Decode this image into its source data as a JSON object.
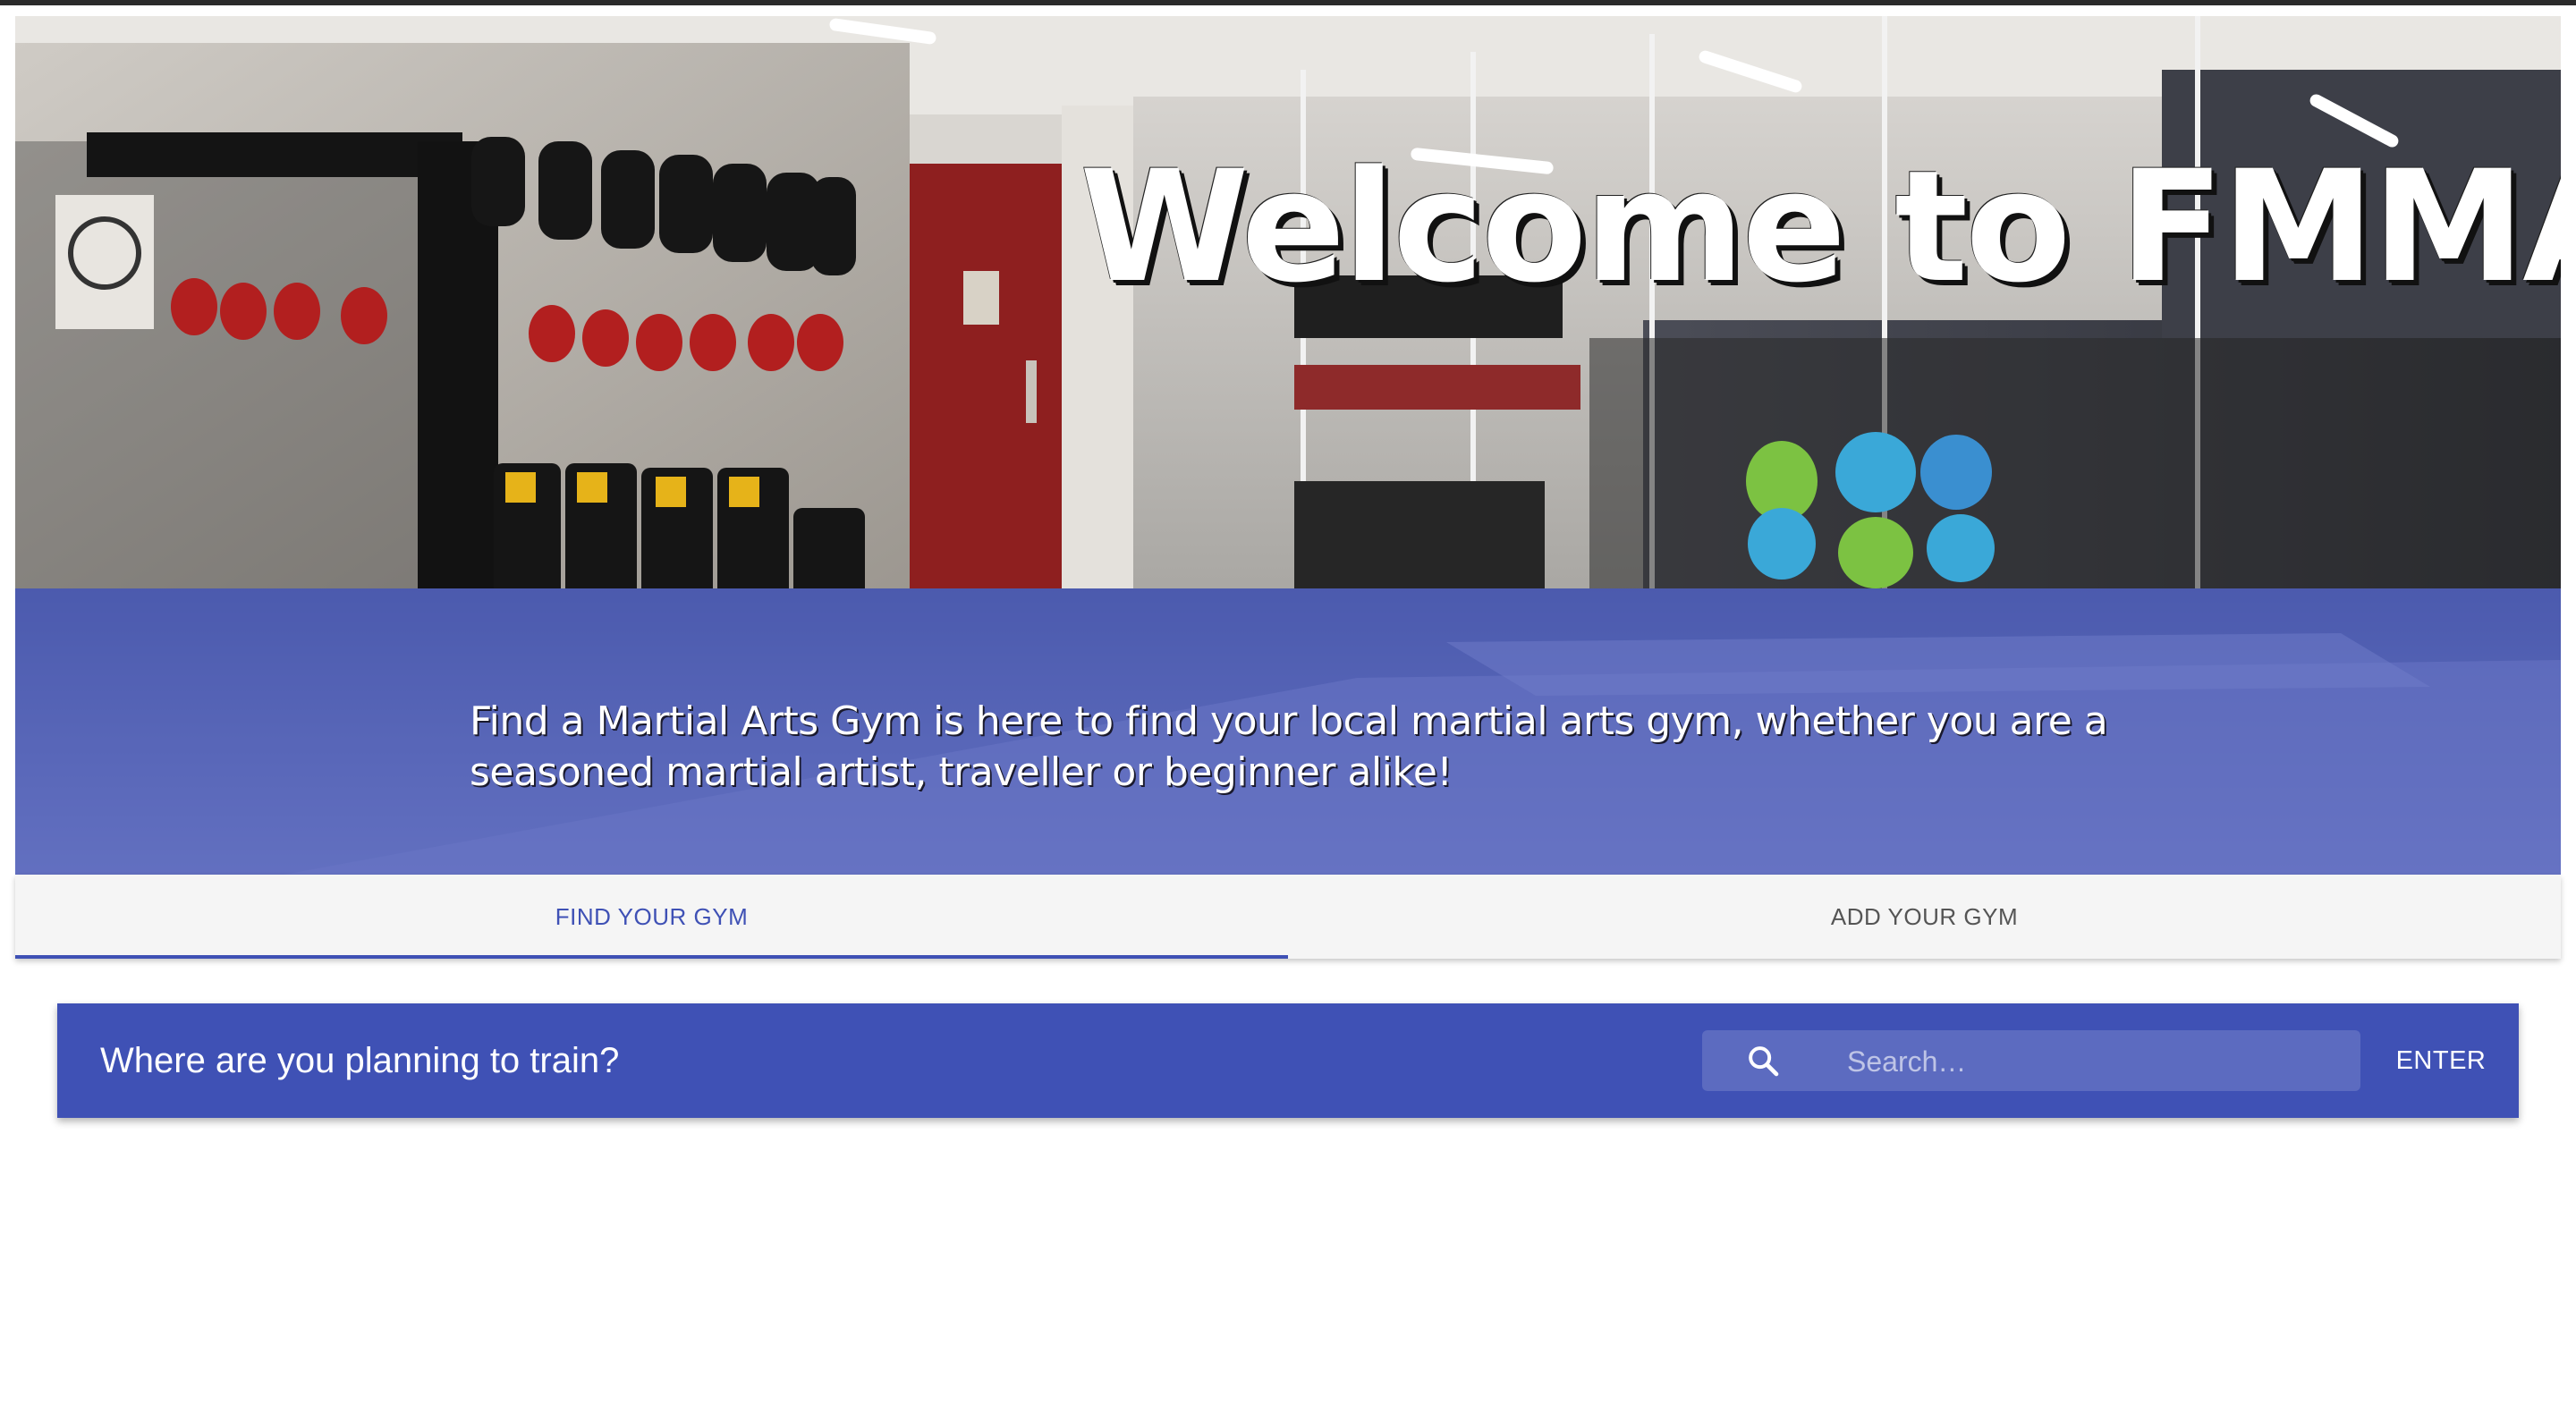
{
  "hero": {
    "title": "Welcome to FMMA!",
    "subtitle": "Find a Martial Arts Gym is here to find your local martial arts gym, whether you are a seasoned martial artist, traveller or beginner alike!",
    "image_description_icon": "gym-photo"
  },
  "tabs": [
    {
      "label": "FIND YOUR GYM",
      "active": true
    },
    {
      "label": "ADD YOUR GYM",
      "active": false
    }
  ],
  "search": {
    "heading": "Where are you planning to train?",
    "placeholder": "Search…",
    "value": "",
    "enter_label": "ENTER",
    "icon": "search-icon"
  },
  "colors": {
    "primary": "#3f51b5",
    "primary_light": "#5c6bc0",
    "tab_bg": "#f5f5f5"
  }
}
